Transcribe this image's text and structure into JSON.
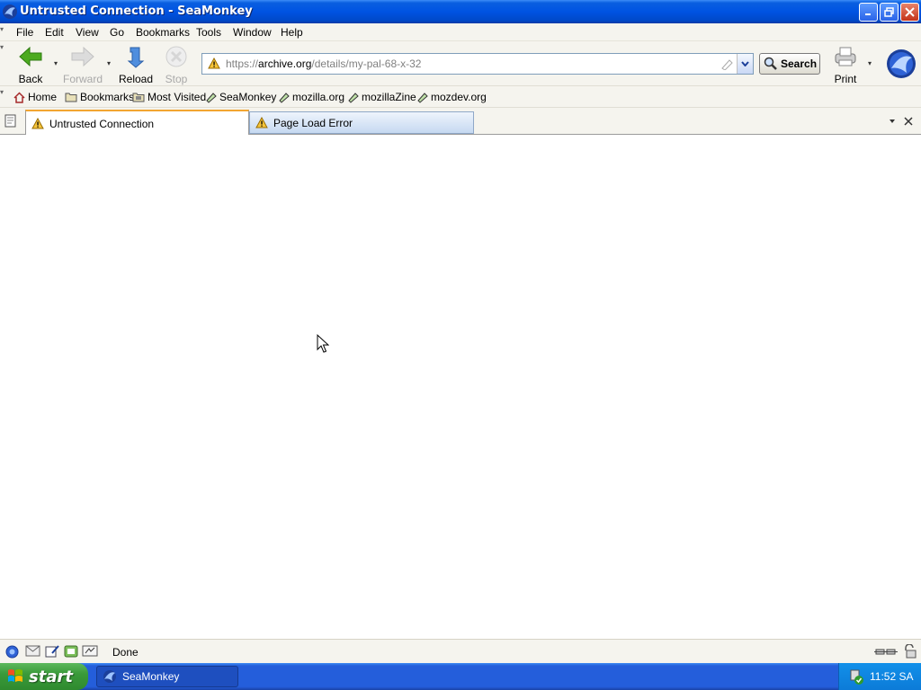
{
  "window": {
    "title": "Untrusted Connection - SeaMonkey"
  },
  "menu": [
    "File",
    "Edit",
    "View",
    "Go",
    "Bookmarks",
    "Tools",
    "Window",
    "Help"
  ],
  "nav": {
    "back": "Back",
    "forward": "Forward",
    "reload": "Reload",
    "stop": "Stop",
    "print": "Print"
  },
  "url": {
    "prefix": "https://",
    "domain": "archive.org",
    "path": "/details/my-pal-68-x-32"
  },
  "search_label": "Search",
  "personal_bar": [
    "Home",
    "Bookmarks",
    "Most Visited",
    "SeaMonkey",
    "mozilla.org",
    "mozillaZine",
    "mozdev.org"
  ],
  "tabs": [
    "Untrusted Connection",
    "Page Load Error"
  ],
  "status": "Done",
  "taskbar": {
    "start": "start",
    "item": "SeaMonkey",
    "clock": "11:52 SA"
  }
}
